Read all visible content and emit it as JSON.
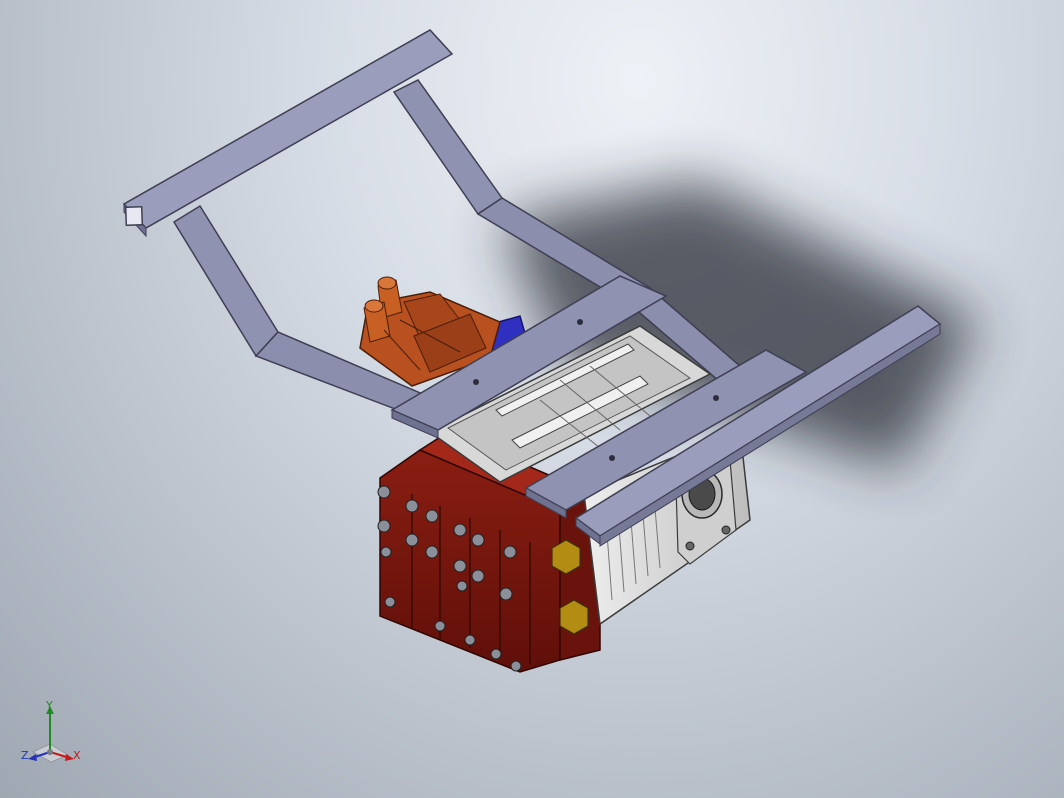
{
  "viewport": {
    "background_top": "#eef1f6",
    "background_bottom": "#9fa7b2"
  },
  "model": {
    "frame_color": "#8f92b1",
    "manifold_color": "#7d1710",
    "distributor_color": "#b9501f",
    "motor_color": "#d9d9d9",
    "accent_blue": "#2f2fc0",
    "nut_color": "#b38d13"
  },
  "triad": {
    "x_label": "X",
    "y_label": "Y",
    "z_label": "Z",
    "x_color": "#c41a1a",
    "y_color": "#1f8a1f",
    "z_color": "#2433b8"
  }
}
